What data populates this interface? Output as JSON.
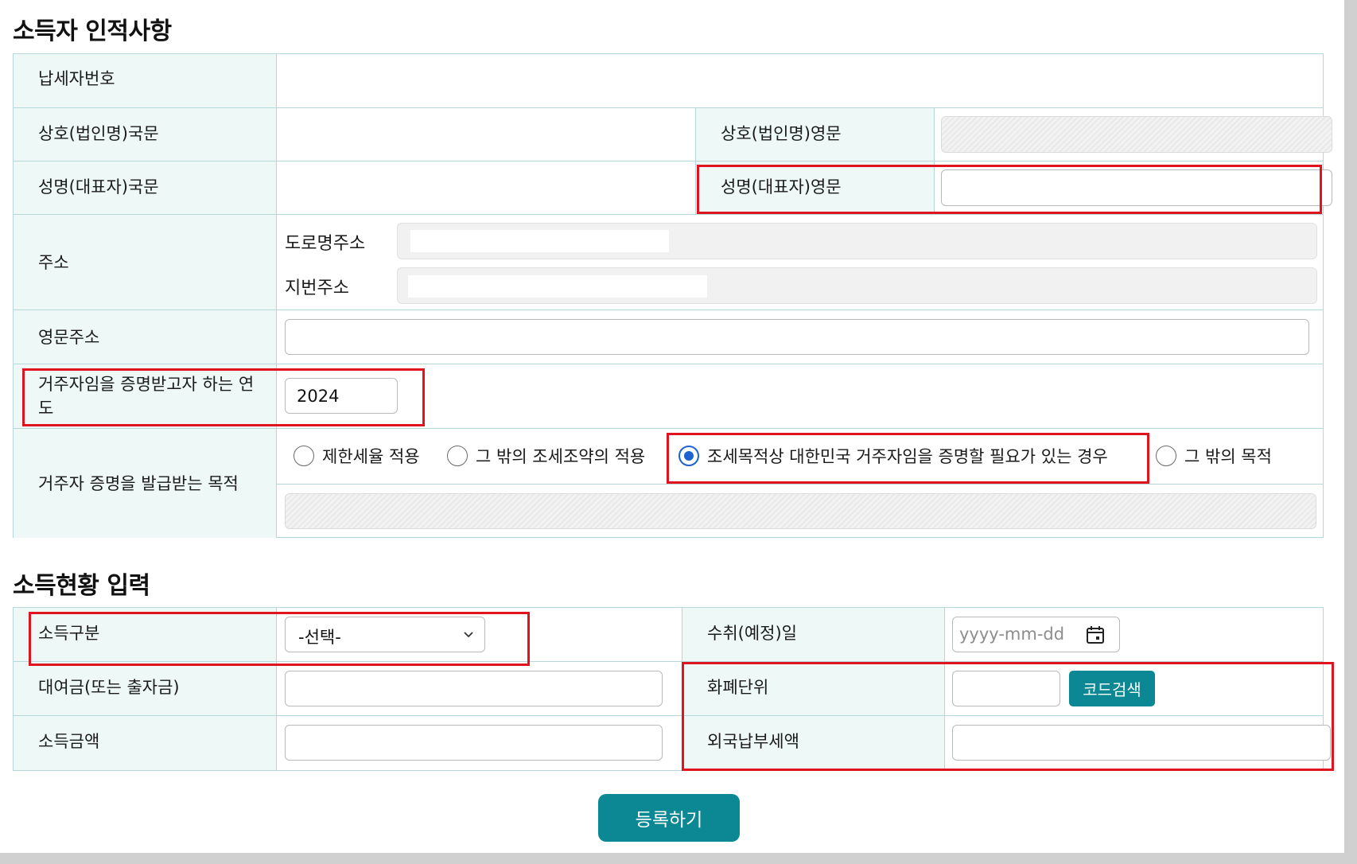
{
  "section1": {
    "title": "소득자 인적사항",
    "taxpayer_number_label": "납세자번호",
    "company_kr_label": "상호(법인명)국문",
    "company_en_label": "상호(법인명)영문",
    "name_kr_label": "성명(대표자)국문",
    "name_en_label": "성명(대표자)영문",
    "address_label": "주소",
    "road_address_label": "도로명주소",
    "lot_address_label": "지번주소",
    "english_address_label": "영문주소",
    "year_label": "거주자임을 증명받고자 하는 연도",
    "year_value": "2024",
    "purpose_label": "거주자 증명을 발급받는 목적",
    "purpose_options": [
      {
        "label": "제한세율 적용",
        "selected": false
      },
      {
        "label": "그 밖의 조세조약의 적용",
        "selected": false
      },
      {
        "label": "조세목적상 대한민국 거주자임을 증명할 필요가 있는 경우",
        "selected": true
      },
      {
        "label": "그 밖의 목적",
        "selected": false
      }
    ]
  },
  "section2": {
    "title": "소득현황 입력",
    "income_type_label": "소득구분",
    "income_type_selected": "-선택-",
    "receipt_date_label": "수취(예정)일",
    "receipt_date_placeholder": "yyyy-mm-dd",
    "loan_label": "대여금(또는 출자금)",
    "currency_label": "화폐단위",
    "code_search_label": "코드검색",
    "income_amount_label": "소득금액",
    "foreign_tax_label": "외국납부세액"
  },
  "submit_label": "등록하기",
  "icons": {
    "dropdown": "chevron-down-icon",
    "calendar": "calendar-icon"
  },
  "colors": {
    "accent": "#0b8893",
    "highlight": "#e0141e",
    "label_bg": "#eef8f7",
    "radio_selected": "#1e62d0"
  }
}
